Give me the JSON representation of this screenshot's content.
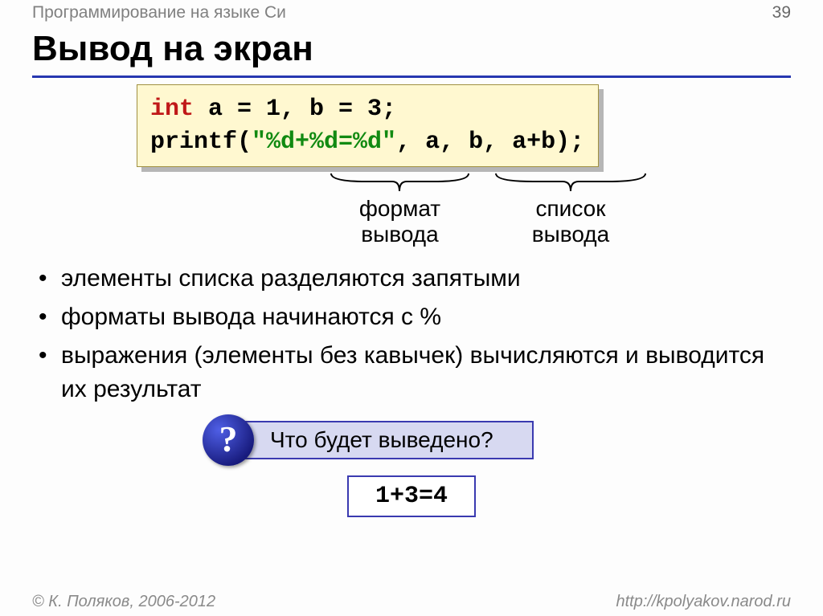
{
  "header": {
    "course": "Программирование на языке Си",
    "page": "39"
  },
  "title": "Вывод на экран",
  "code": {
    "line1_kw": "int",
    "line1_rest": " a = 1, b = 3;",
    "line2_pre": "printf(",
    "line2_str": "\"%d+%d=%d\"",
    "line2_post": ", a, b, a+b);"
  },
  "braces": {
    "format": {
      "l1": "формат",
      "l2": "вывода"
    },
    "list": {
      "l1": "список",
      "l2": "вывода"
    }
  },
  "bullets": [
    "элементы списка разделяются запятыми",
    "форматы вывода начинаются с %",
    "выражения (элементы без кавычек) вычисляются и выводится их результат"
  ],
  "question": "Что будет выведено?",
  "result": "1+3=4",
  "footer": {
    "copyright": "© К. Поляков, 2006-2012",
    "url": "http://kpolyakov.narod.ru"
  }
}
